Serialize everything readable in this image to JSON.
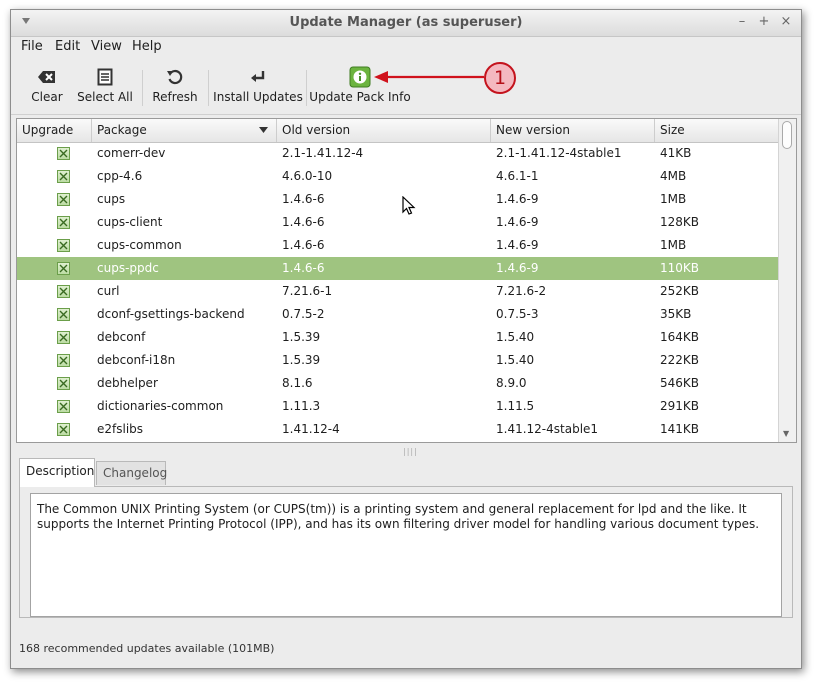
{
  "window": {
    "title": "Update Manager (as superuser)",
    "controls": [
      "–",
      "+",
      "×"
    ]
  },
  "menu": [
    "File",
    "Edit",
    "View",
    "Help"
  ],
  "toolbar": {
    "clear": "Clear",
    "select_all": "Select All",
    "refresh": "Refresh",
    "install_updates": "Install Updates",
    "update_pack_info": "Update Pack Info"
  },
  "table": {
    "headers": [
      "Upgrade",
      "Package",
      "Old version",
      "New version",
      "Size"
    ],
    "rows": [
      {
        "package": "comerr-dev",
        "old": "2.1-1.41.12-4",
        "new": "2.1-1.41.12-4stable1",
        "size": "41KB"
      },
      {
        "package": "cpp-4.6",
        "old": "4.6.0-10",
        "new": "4.6.1-1",
        "size": "4MB"
      },
      {
        "package": "cups",
        "old": "1.4.6-6",
        "new": "1.4.6-9",
        "size": "1MB"
      },
      {
        "package": "cups-client",
        "old": "1.4.6-6",
        "new": "1.4.6-9",
        "size": "128KB"
      },
      {
        "package": "cups-common",
        "old": "1.4.6-6",
        "new": "1.4.6-9",
        "size": "1MB"
      },
      {
        "package": "cups-ppdc",
        "old": "1.4.6-6",
        "new": "1.4.6-9",
        "size": "110KB",
        "selected": true
      },
      {
        "package": "curl",
        "old": "7.21.6-1",
        "new": "7.21.6-2",
        "size": "252KB"
      },
      {
        "package": "dconf-gsettings-backend",
        "old": "0.7.5-2",
        "new": "0.7.5-3",
        "size": "35KB"
      },
      {
        "package": "debconf",
        "old": "1.5.39",
        "new": "1.5.40",
        "size": "164KB"
      },
      {
        "package": "debconf-i18n",
        "old": "1.5.39",
        "new": "1.5.40",
        "size": "222KB"
      },
      {
        "package": "debhelper",
        "old": "8.1.6",
        "new": "8.9.0",
        "size": "546KB"
      },
      {
        "package": "dictionaries-common",
        "old": "1.11.3",
        "new": "1.11.5",
        "size": "291KB"
      },
      {
        "package": "e2fslibs",
        "old": "1.41.12-4",
        "new": "1.41.12-4stable1",
        "size": "141KB"
      }
    ]
  },
  "tabs": {
    "description": "Description",
    "changelog": "Changelog"
  },
  "description": "The Common UNIX Printing System (or CUPS(tm)) is a printing system and general replacement for lpd and the like.  It supports the Internet Printing Protocol (IPP), and has its own filtering driver model for handling various document types.",
  "status": "168 recommended updates available (101MB)",
  "annotation": {
    "label": "1",
    "color": "#c4131d"
  },
  "colors": {
    "selected_row": "#9fc480",
    "checkbox": "#6b9e4a"
  }
}
